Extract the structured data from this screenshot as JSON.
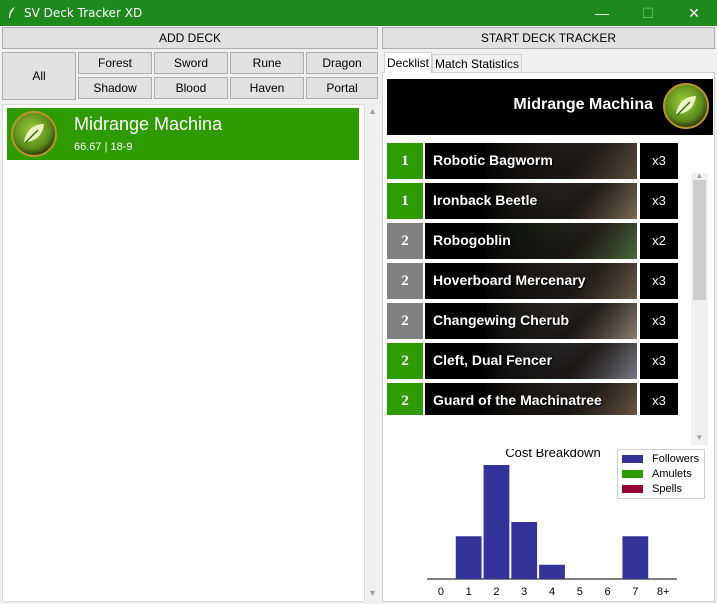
{
  "window": {
    "title": "SV Deck Tracker XD",
    "minimize_glyph": "—",
    "maximize_glyph": "☐",
    "close_glyph": "✕"
  },
  "toolbar": {
    "add_deck_label": "ADD DECK",
    "start_tracker_label": "START DECK TRACKER"
  },
  "filters": {
    "all_label": "All",
    "crafts": [
      "Forest",
      "Sword",
      "Rune",
      "Dragon",
      "Shadow",
      "Blood",
      "Haven",
      "Portal"
    ]
  },
  "decks": [
    {
      "name": "Midrange Machina",
      "stats": "66.67 | 18-9",
      "craft_icon": "forest-leaf-icon",
      "color": "#2e9b00"
    }
  ],
  "tabs": {
    "decklist_label": "Decklist",
    "stats_label": "Match Statistics"
  },
  "decklist": {
    "deck_name": "Midrange Machina",
    "cards": [
      {
        "cost": "1",
        "name": "Robotic Bagworm",
        "count": "x3",
        "cost_color": "#2e9b00",
        "art_color": "#5a4e3c"
      },
      {
        "cost": "1",
        "name": "Ironback Beetle",
        "count": "x3",
        "cost_color": "#2e9b00",
        "art_color": "#7a6c52"
      },
      {
        "cost": "2",
        "name": "Robogoblin",
        "count": "x2",
        "cost_color": "#808080",
        "art_color": "#4a6a3a"
      },
      {
        "cost": "2",
        "name": "Hoverboard Mercenary",
        "count": "x3",
        "cost_color": "#808080",
        "art_color": "#6a5a48"
      },
      {
        "cost": "2",
        "name": "Changewing Cherub",
        "count": "x3",
        "cost_color": "#808080",
        "art_color": "#8a8070"
      },
      {
        "cost": "2",
        "name": "Cleft, Dual Fencer",
        "count": "x3",
        "cost_color": "#2e9b00",
        "art_color": "#7a7a86"
      },
      {
        "cost": "2",
        "name": "Guard of the Machinatree",
        "count": "x3",
        "cost_color": "#2e9b00",
        "art_color": "#6a5a40"
      }
    ]
  },
  "chart_data": {
    "type": "bar",
    "title": "Cost Breakdown",
    "categories": [
      "0",
      "1",
      "2",
      "3",
      "4",
      "5",
      "6",
      "7",
      "8+"
    ],
    "series": [
      {
        "name": "Followers",
        "color": "#333399",
        "values": [
          0,
          3,
          8,
          4,
          1,
          0,
          0,
          3,
          0
        ]
      },
      {
        "name": "Amulets",
        "color": "#2e9b00",
        "values": [
          0,
          0,
          0,
          0,
          0,
          0,
          0,
          0,
          0
        ]
      },
      {
        "name": "Spells",
        "color": "#990033",
        "values": [
          0,
          0,
          0,
          0,
          0,
          0,
          0,
          0,
          0
        ]
      }
    ],
    "ylim": [
      0,
      8
    ],
    "legend": "top-right",
    "grid": false
  }
}
